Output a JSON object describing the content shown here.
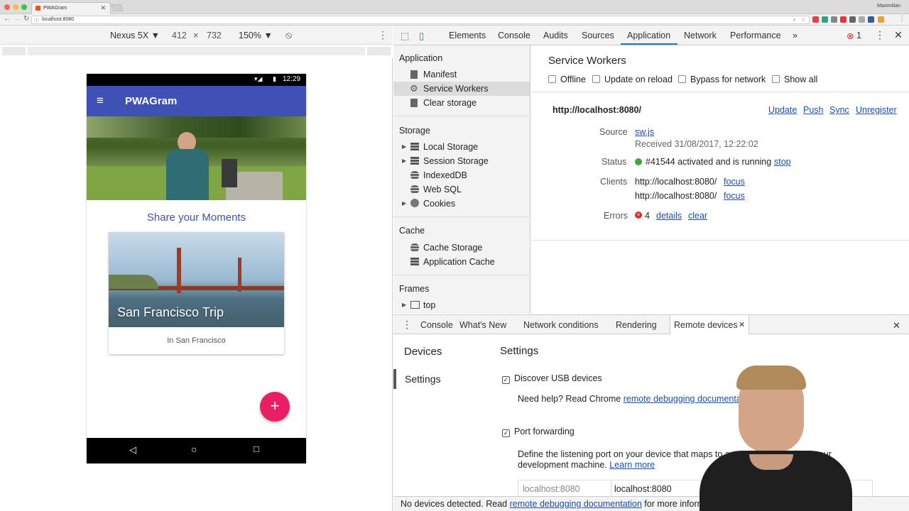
{
  "browser": {
    "tab_title": "PWAGram",
    "url": "localhost:8080",
    "user_name": "Maximilian"
  },
  "device_toolbar": {
    "device": "Nexus 5X ▼",
    "width": "412",
    "times": "×",
    "height": "732",
    "zoom": "150% ▼"
  },
  "phone": {
    "time": "12:29",
    "app_title": "PWAGram",
    "share_heading": "Share your Moments",
    "card_title": "San Francisco Trip",
    "card_location": "In San Francisco",
    "fab_label": "+"
  },
  "devtools": {
    "tabs": [
      "Elements",
      "Console",
      "Audits",
      "Sources",
      "Application",
      "Network",
      "Performance",
      "»"
    ],
    "error_count": "1",
    "sidebar": {
      "application_header": "Application",
      "application_items": [
        "Manifest",
        "Service Workers",
        "Clear storage"
      ],
      "storage_header": "Storage",
      "storage_items": [
        "Local Storage",
        "Session Storage",
        "IndexedDB",
        "Web SQL",
        "Cookies"
      ],
      "cache_header": "Cache",
      "cache_items": [
        "Cache Storage",
        "Application Cache"
      ],
      "frames_header": "Frames",
      "frames_items": [
        "top"
      ]
    },
    "service_workers": {
      "title": "Service Workers",
      "options": [
        "Offline",
        "Update on reload",
        "Bypass for network",
        "Show all"
      ],
      "origin": "http://localhost:8080/",
      "actions": [
        "Update",
        "Push",
        "Sync",
        "Unregister"
      ],
      "source_label": "Source",
      "source_file": "sw.js",
      "received": "Received 31/08/2017, 12:22:02",
      "status_label": "Status",
      "status_text": "#41544 activated and is running",
      "status_action": "stop",
      "clients_label": "Clients",
      "clients": [
        "http://localhost:8080/",
        "http://localhost:8080/"
      ],
      "client_action": "focus",
      "errors_label": "Errors",
      "errors_count": "4",
      "errors_actions": [
        "details",
        "clear"
      ]
    },
    "drawer": {
      "tabs": [
        "Console",
        "What's New",
        "Network conditions",
        "Rendering",
        "Remote devices"
      ],
      "nav": [
        "Devices",
        "Settings"
      ],
      "settings_title": "Settings",
      "discover_usb": "Discover USB devices",
      "help_prefix": "Need help? Read Chrome ",
      "help_link": "remote debugging documentation",
      "port_forwarding": "Port forwarding",
      "pf_desc_1": "Define the listening port on your device that maps to a port accessible from your",
      "pf_desc_2": "development machine. ",
      "learn_more": "Learn more",
      "pf_device_port": "localhost:8080",
      "pf_local_address": "localhost:8080"
    },
    "footer": {
      "prefix": "No devices detected. Read ",
      "link": "remote debugging documentation",
      "suffix": " for more information."
    }
  },
  "colors": {
    "app_bar": "#3f51b5",
    "fab": "#e91e63",
    "link": "#1a4fb3",
    "status_ok": "#3aa843",
    "error_red": "#d93025"
  }
}
